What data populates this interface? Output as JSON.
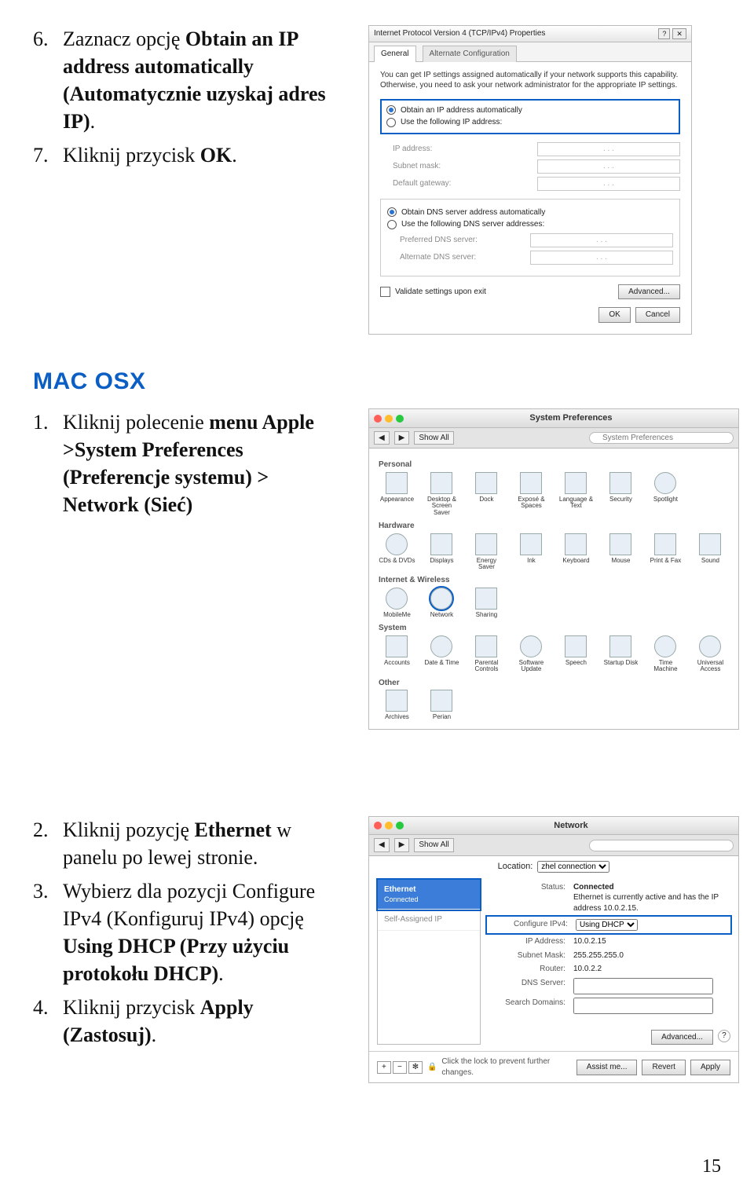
{
  "steps_top": {
    "n6": "6.",
    "s6_pre": "Zaznacz opcję ",
    "s6_b": "Obtain an IP address automatically (Automatycznie uzyskaj adres IP)",
    "s6_post": ".",
    "n7": "7.",
    "s7_pre": "Kliknij przycisk ",
    "s7_b": "OK",
    "s7_post": "."
  },
  "heading_mac": "MAC OSX",
  "steps_mac1": {
    "n1": "1.",
    "s1_pre": "Kliknij polecenie ",
    "s1_b": "menu Apple >System Preferences (Preferencje systemu) > Network (Sieć)"
  },
  "steps_mac2": {
    "n2": "2.",
    "s2_pre": "Kliknij pozycję ",
    "s2_b": "Ethernet",
    "s2_post": " w panelu po lewej stronie.",
    "n3": "3.",
    "s3_pre": "Wybierz dla pozycji Configure IPv4 (Konfiguruj IPv4) opcję ",
    "s3_b": "Using DHCP (Przy użyciu protokołu DHCP)",
    "s3_post": ".",
    "n4": "4.",
    "s4_pre": "Kliknij przycisk ",
    "s4_b": "Apply (Zastosuj)",
    "s4_post": "."
  },
  "ipv4_dialog": {
    "title": "Internet Protocol Version 4 (TCP/IPv4) Properties",
    "help_btn": "?",
    "close_btn": "✕",
    "tab_general": "General",
    "tab_alt": "Alternate Configuration",
    "desc": "You can get IP settings assigned automatically if your network supports this capability. Otherwise, you need to ask your network administrator for the appropriate IP settings.",
    "r_obtain_ip": "Obtain an IP address automatically",
    "r_use_ip": "Use the following IP address:",
    "lbl_ip": "IP address:",
    "lbl_subnet": "Subnet mask:",
    "lbl_gateway": "Default gateway:",
    "r_obtain_dns": "Obtain DNS server address automatically",
    "r_use_dns": "Use the following DNS server addresses:",
    "lbl_pref_dns": "Preferred DNS server:",
    "lbl_alt_dns": "Alternate DNS server:",
    "chk_validate": "Validate settings upon exit",
    "btn_adv": "Advanced...",
    "btn_ok": "OK",
    "btn_cancel": "Cancel",
    "ipdots": ".     .     ."
  },
  "sysprefs": {
    "title": "System Preferences",
    "showall": "Show All",
    "sections": {
      "personal": "Personal",
      "hardware": "Hardware",
      "internet": "Internet & Wireless",
      "system": "System",
      "other": "Other"
    },
    "icons": {
      "appearance": "Appearance",
      "desktop": "Desktop & Screen Saver",
      "dock": "Dock",
      "expose": "Exposé & Spaces",
      "language": "Language & Text",
      "security": "Security",
      "spotlight": "Spotlight",
      "cds": "CDs & DVDs",
      "displays": "Displays",
      "energy": "Energy Saver",
      "ink": "Ink",
      "keyboard": "Keyboard",
      "mouse": "Mouse",
      "printfax": "Print & Fax",
      "sound": "Sound",
      "mobileme": "MobileMe",
      "network": "Network",
      "sharing": "Sharing",
      "accounts": "Accounts",
      "datetime": "Date & Time",
      "parental": "Parental Controls",
      "swupdate": "Software Update",
      "speech": "Speech",
      "startup": "Startup Disk",
      "timemachine": "Time Machine",
      "universal": "Universal Access",
      "archives": "Archives",
      "perian": "Perian"
    }
  },
  "network": {
    "title": "Network",
    "showall": "Show All",
    "loc_label": "Location:",
    "loc_value": "zhel connection",
    "side": {
      "eth_name": "Ethernet",
      "eth_status": "Connected",
      "selfip_name": "Self-Assigned IP"
    },
    "status_k": "Status:",
    "status_val": "Connected",
    "status_sub": "Ethernet is currently active and has the IP address 10.0.2.15.",
    "conf_k": "Configure IPv4:",
    "conf_val": "Using DHCP",
    "ip_k": "IP Address:",
    "ip_v": "10.0.2.15",
    "sub_k": "Subnet Mask:",
    "sub_v": "255.255.255.0",
    "router_k": "Router:",
    "router_v": "10.0.2.2",
    "dns_k": "DNS Server:",
    "search_k": "Search Domains:",
    "advanced": "Advanced...",
    "plus": "+",
    "minus": "−",
    "gear": "✻",
    "lock_txt": "Click the lock to prevent further changes.",
    "assist": "Assist me...",
    "revert": "Revert",
    "apply": "Apply",
    "q": "?"
  },
  "page_number": "15"
}
